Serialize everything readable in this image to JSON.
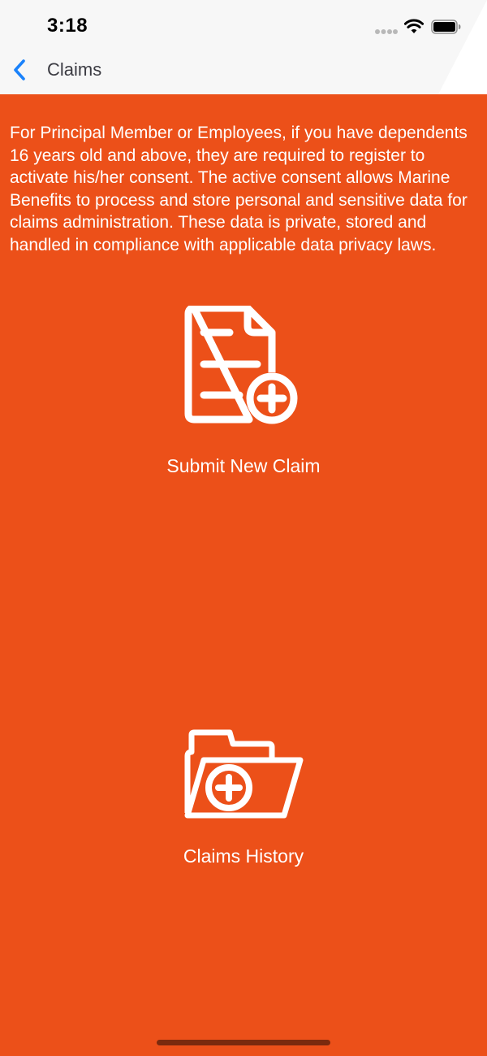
{
  "status_bar": {
    "time": "3:18"
  },
  "nav": {
    "back_title": "Claims"
  },
  "consent_text": "For Principal Member or Employees, if you have dependents 16 years old and above, they are required to register to activate his/her consent. The active consent allows Marine Benefits to process and store personal and sensitive data for claims administration. These data is private, stored and handled in compliance with applicable data privacy laws.",
  "actions": {
    "submit_new_claim": {
      "label": "Submit New Claim",
      "icon": "document-plus-icon"
    },
    "claims_history": {
      "label": "Claims History",
      "icon": "folder-plus-icon"
    }
  },
  "colors": {
    "background": "#ec5019",
    "accent_blue": "#1a82fb",
    "text_light": "#ffffff"
  }
}
